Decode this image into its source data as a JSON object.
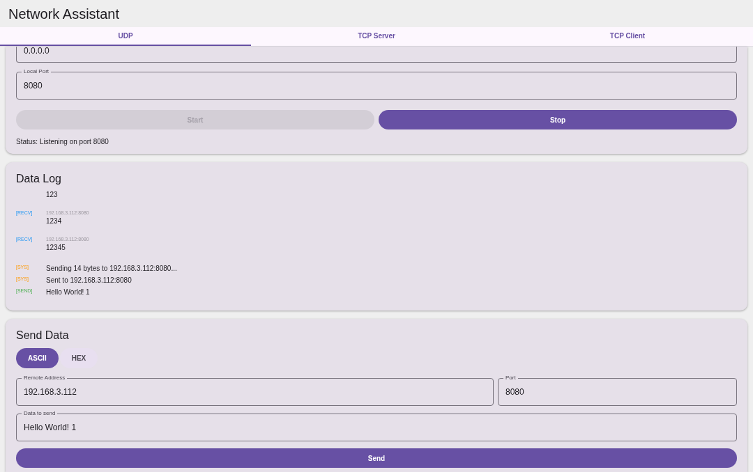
{
  "app_bar": {
    "title": "Network Assistant"
  },
  "tabs": [
    {
      "label": "UDP",
      "selected": true
    },
    {
      "label": "TCP Server",
      "selected": false
    },
    {
      "label": "TCP Client",
      "selected": false
    }
  ],
  "connection": {
    "local_address": {
      "value": "0.0.0.0"
    },
    "local_port": {
      "label": "Local Port",
      "value": "8080"
    },
    "buttons": [
      {
        "label": "Start",
        "disabled": true
      },
      {
        "label": "Stop",
        "disabled": false
      }
    ],
    "status": "Status: Listening on port 8080"
  },
  "data_log": {
    "title": "Data Log",
    "entries": [
      {
        "message": "123"
      },
      {
        "kind": "recv",
        "tag": "[RECV]",
        "source": "192.168.3.112:8080",
        "message": "1234"
      },
      {
        "kind": "recv",
        "tag": "[RECV]",
        "source": "192.168.3.112:8080",
        "message": "12345"
      },
      {
        "kind": "sys",
        "tag": "[SYS]",
        "message": "Sending 14 bytes to 192.168.3.112:8080..."
      },
      {
        "kind": "sys",
        "tag": "[SYS]",
        "message": "Sent to 192.168.3.112:8080"
      },
      {
        "kind": "send",
        "tag": "[SEND]",
        "message": "Hello World! 1"
      }
    ]
  },
  "send_data": {
    "title": "Send Data",
    "modes": [
      {
        "label": "ASCII",
        "selected": true
      },
      {
        "label": "HEX",
        "selected": false
      }
    ],
    "remote_address": {
      "label": "Remote Address",
      "value": "192.168.3.112"
    },
    "port": {
      "label": "Port",
      "value": "8080"
    },
    "data": {
      "label": "Data to send",
      "value": "Hello World! 1"
    },
    "send_button": "Send"
  }
}
